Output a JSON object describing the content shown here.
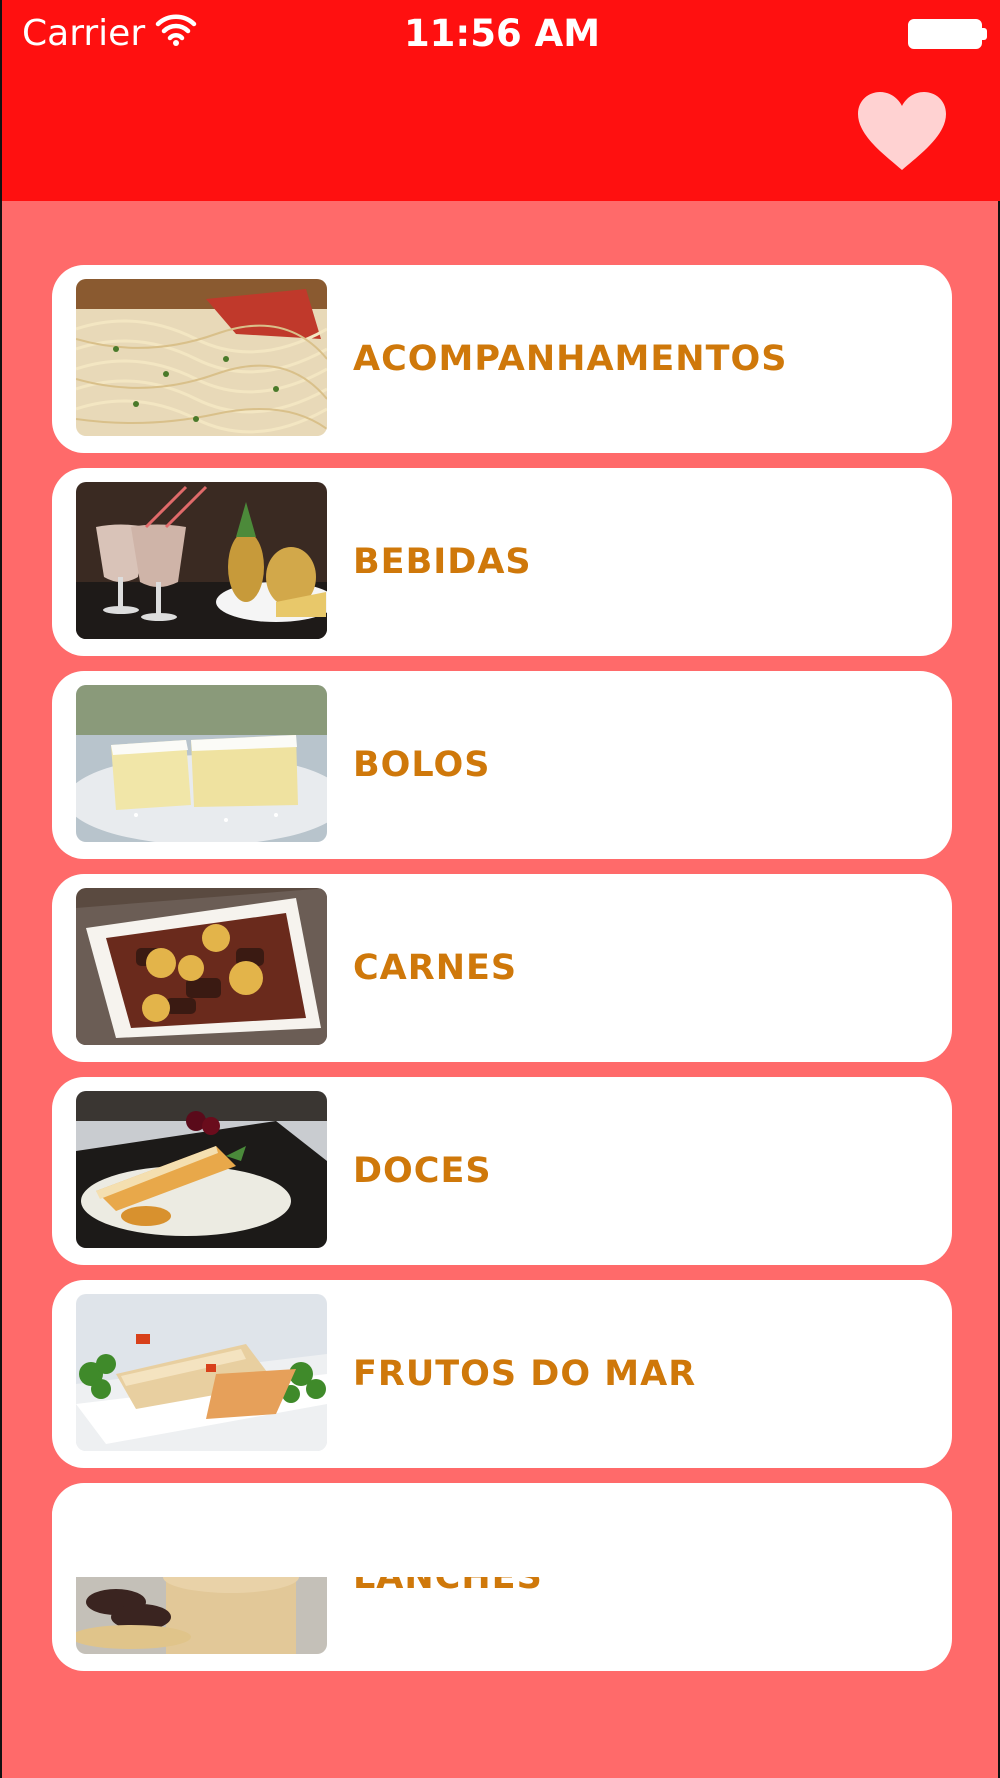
{
  "status_bar": {
    "carrier": "Carrier",
    "time": "11:56 AM",
    "icons": [
      "wifi-icon",
      "battery-icon"
    ]
  },
  "nav_bar": {
    "color": "#ff1010",
    "right_button_icon": "heart-icon"
  },
  "categories": [
    {
      "label": "ACOMPANHAMENTOS"
    },
    {
      "label": "BEBIDAS"
    },
    {
      "label": "BOLOS"
    },
    {
      "label": "CARNES"
    },
    {
      "label": "DOCES"
    },
    {
      "label": "FRUTOS DO MAR"
    },
    {
      "label": "LANCHES"
    }
  ],
  "colors": {
    "background": "#ff6a6a",
    "card": "#ffffff",
    "label": "#cf780a",
    "heart": "#ffd2d2"
  }
}
